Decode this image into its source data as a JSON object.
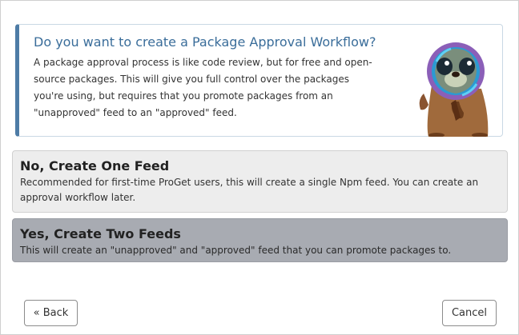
{
  "info": {
    "title": "Do you want to create a Package Approval Workflow?",
    "body": "A package approval process is like code review, but for free and open-source packages. This will give you full control over the packages you're using, but requires that you promote packages from an \"unapproved\" feed to an \"approved\" feed."
  },
  "options": [
    {
      "title": "No, Create One Feed",
      "description": "Recommended for first-time ProGet users, this will create a single Npm feed. You can create an approval workflow later."
    },
    {
      "title": "Yes, Create Two Feeds",
      "description": "This will create an \"unapproved\" and \"approved\" feed that you can promote packages to."
    }
  ],
  "buttons": {
    "back": "« Back",
    "cancel": "Cancel"
  },
  "colors": {
    "accent": "#4e7ca6",
    "title": "#3a6d9a",
    "option_selected_bg": "#a8abb2",
    "option_bg": "#ededed"
  },
  "icons": {
    "mascot": "groundhog-with-magnifying-glass"
  }
}
